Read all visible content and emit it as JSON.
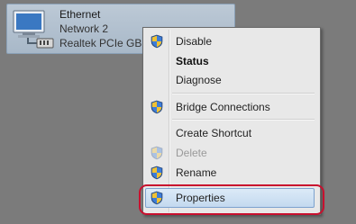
{
  "adapter": {
    "name": "Ethernet",
    "network": "Network  2",
    "device": "Realtek PCIe GBE Family Controller",
    "icon": "network-adapter-icon"
  },
  "menu": {
    "items": [
      {
        "label": "Disable",
        "icon": "uac-shield-icon",
        "disabled": false
      },
      {
        "label": "Status",
        "bold": true
      },
      {
        "label": "Diagnose"
      },
      {
        "label": "Bridge Connections",
        "icon": "uac-shield-icon"
      },
      {
        "label": "Create Shortcut"
      },
      {
        "label": "Delete",
        "icon": "uac-shield-icon",
        "disabled": true
      },
      {
        "label": "Rename",
        "icon": "uac-shield-icon"
      },
      {
        "label": "Properties",
        "icon": "uac-shield-icon",
        "hovered": true
      }
    ]
  },
  "colors": {
    "highlight_ring": "#c8102e",
    "hover_border": "#7da2ce",
    "background": "#7b7b7b"
  }
}
